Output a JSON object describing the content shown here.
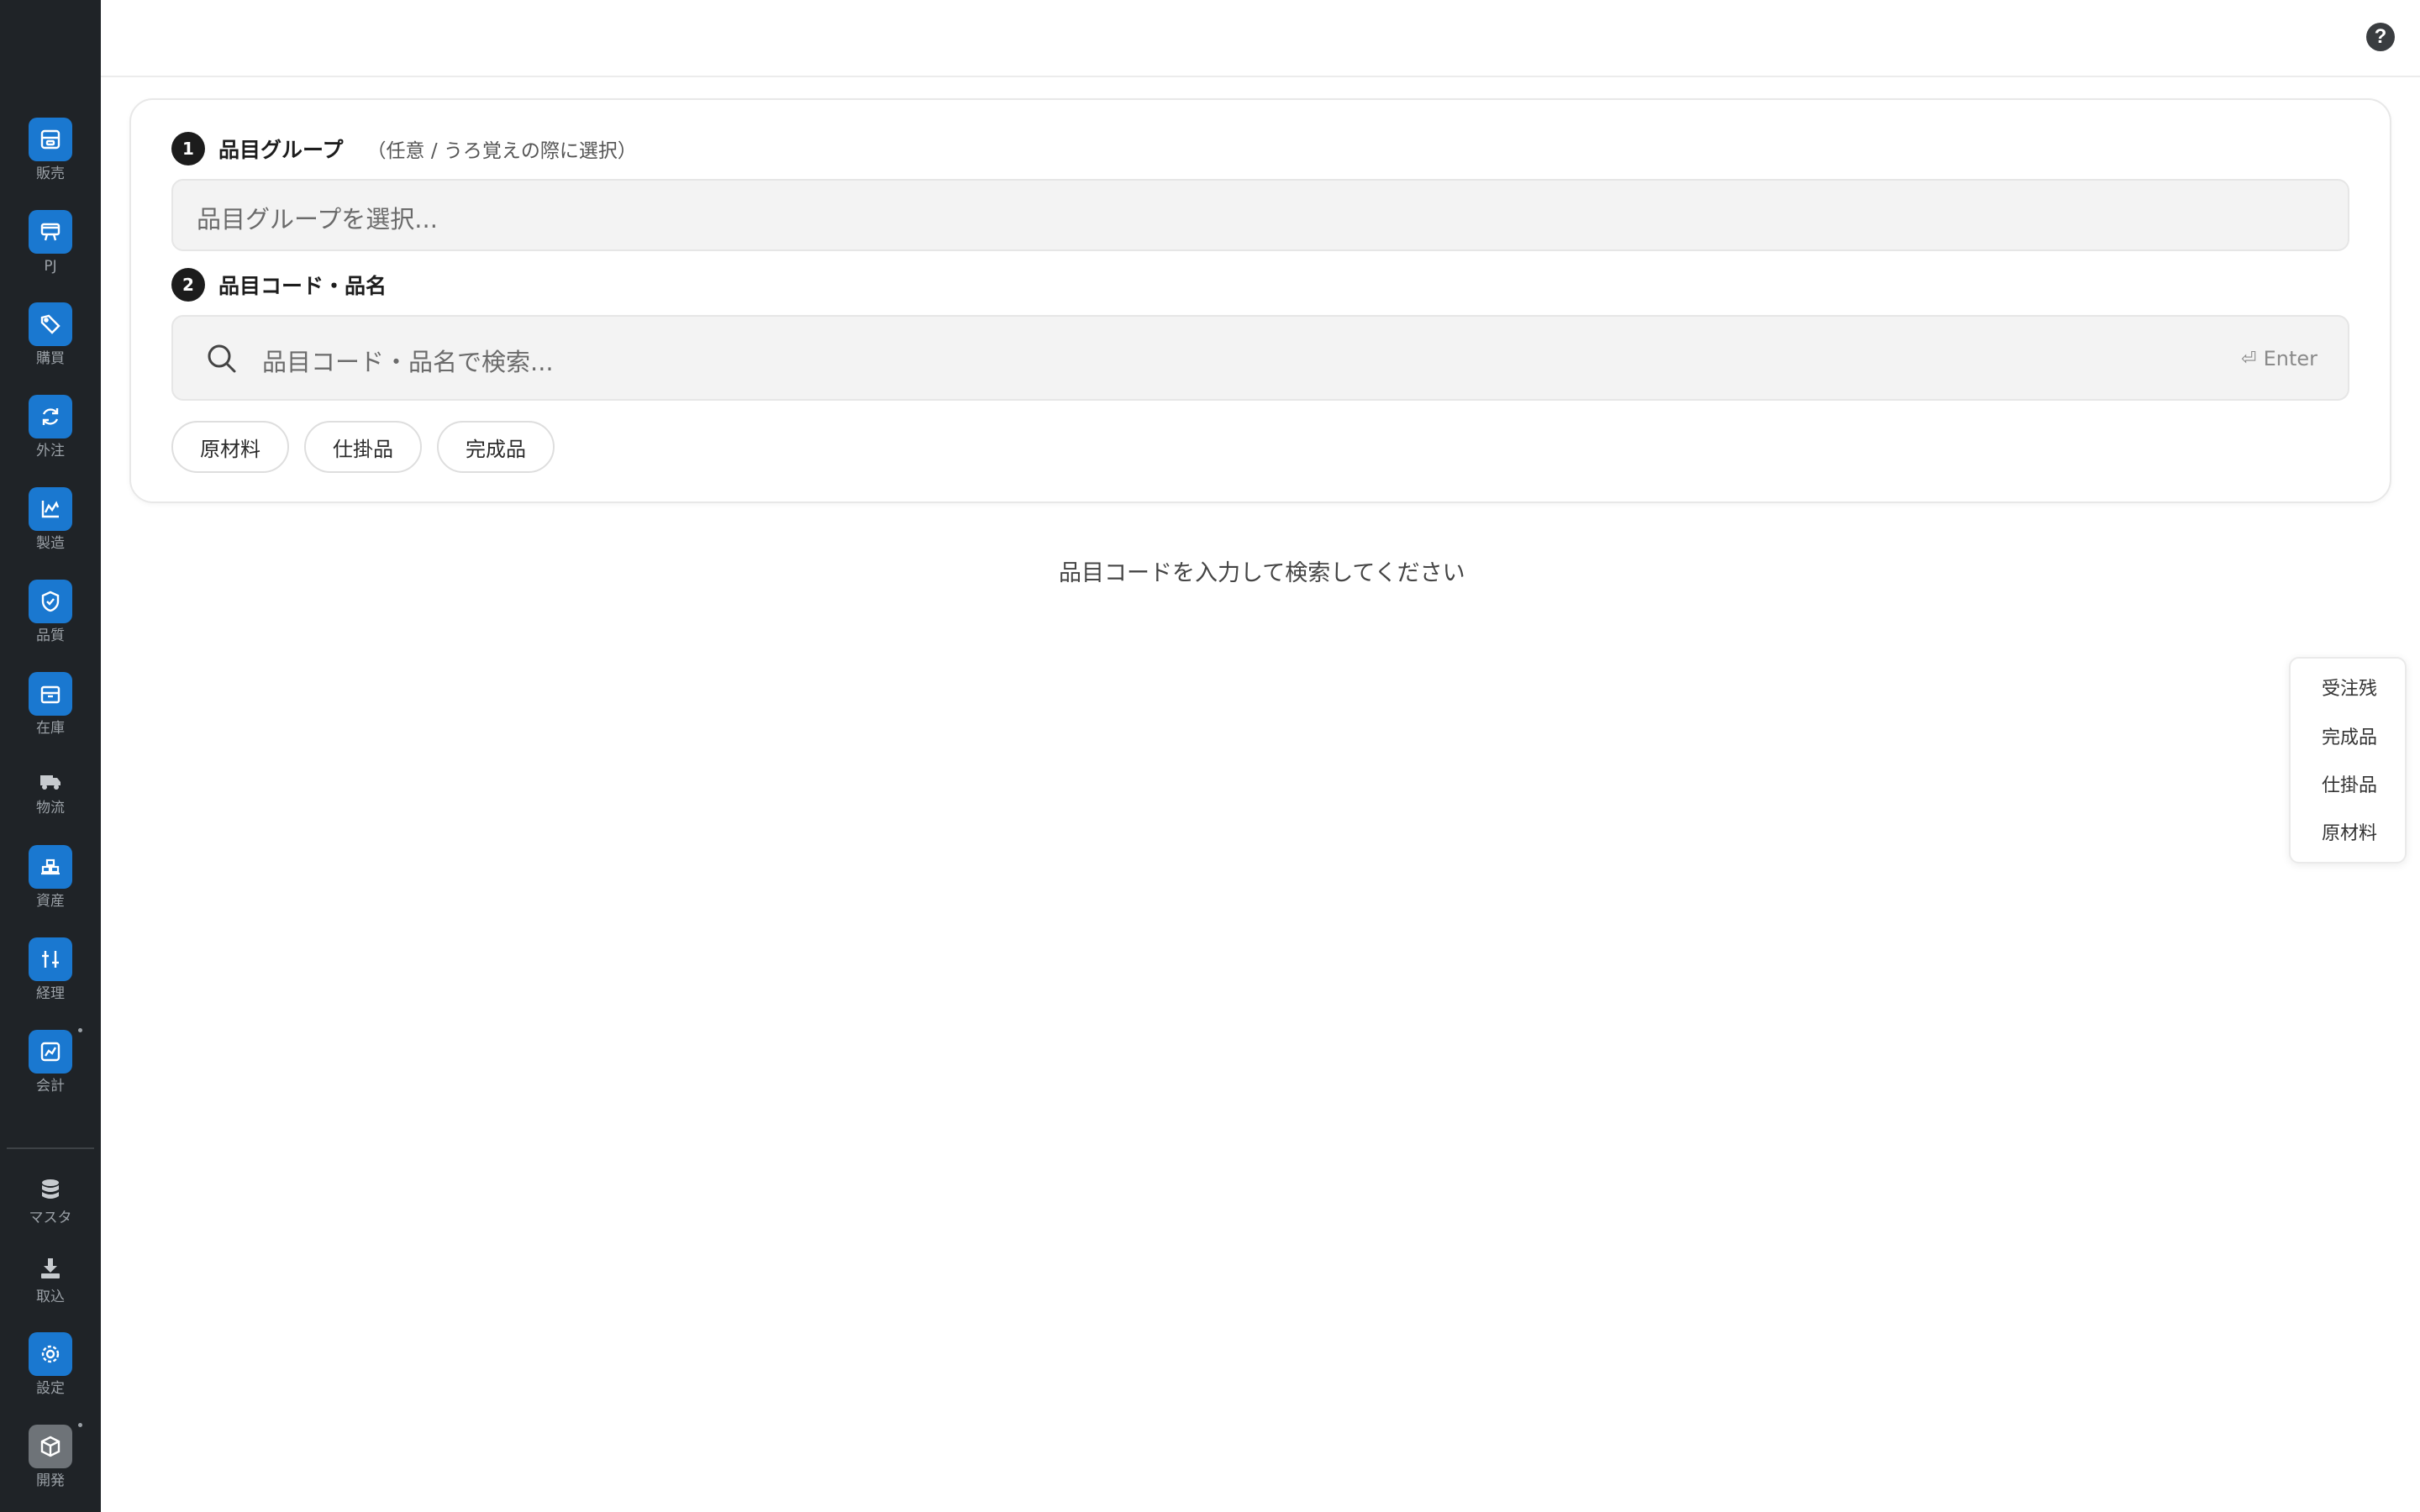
{
  "sidebar": {
    "items": [
      {
        "label": "販売",
        "icon": "sales-icon"
      },
      {
        "label": "PJ",
        "icon": "project-icon"
      },
      {
        "label": "購買",
        "icon": "tag-icon"
      },
      {
        "label": "外注",
        "icon": "refresh-icon"
      },
      {
        "label": "製造",
        "icon": "factory-chart-icon"
      },
      {
        "label": "品質",
        "icon": "shield-check-icon"
      },
      {
        "label": "在庫",
        "icon": "box-icon"
      },
      {
        "label": "物流",
        "icon": "truck-icon"
      },
      {
        "label": "資産",
        "icon": "assets-icon"
      },
      {
        "label": "経理",
        "icon": "sliders-icon"
      },
      {
        "label": "会計",
        "icon": "chart-icon"
      },
      {
        "label": "マスタ",
        "icon": "database-icon"
      },
      {
        "label": "取込",
        "icon": "download-icon"
      },
      {
        "label": "設定",
        "icon": "gear-icon"
      },
      {
        "label": "開発",
        "icon": "cube-icon"
      }
    ]
  },
  "header": {
    "help_icon": "question-icon",
    "help_glyph": "?"
  },
  "form": {
    "step1": {
      "num": "1",
      "title": "品目グループ",
      "hint": "（任意 / うろ覚えの際に選択）",
      "placeholder": "品目グループを選択..."
    },
    "step2": {
      "num": "2",
      "title": "品目コード・品名",
      "placeholder": "品目コード・品名で検索...",
      "enter_label": "Enter",
      "enter_glyph": "⏎"
    },
    "chips": [
      "原材料",
      "仕掛品",
      "完成品"
    ]
  },
  "empty_message": "品目コードを入力して検索してください",
  "jump_menu": [
    "受注残",
    "完成品",
    "仕掛品",
    "原材料"
  ],
  "colors": {
    "sidebar_bg": "#1f2327",
    "accent": "#1a78d0",
    "dev_tile": "#6e7378"
  }
}
